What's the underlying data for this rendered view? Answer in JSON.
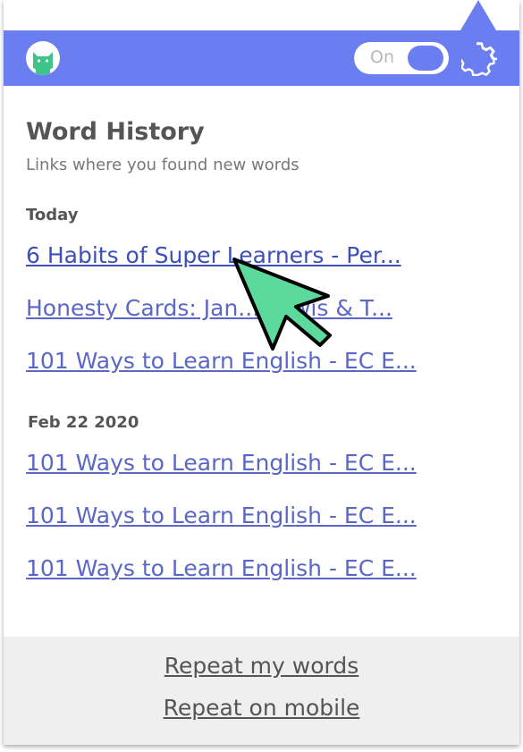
{
  "header": {
    "toggle_label": "On",
    "accent_color": "#6a7ef2",
    "logo_icon": "cat-mascot-icon",
    "settings_icon": "gear-icon"
  },
  "history": {
    "title": "Word History",
    "subtitle": "Links where you found new words",
    "groups": [
      {
        "date": "Today",
        "links": [
          "6 Habits of Super Learners - Per...",
          "Honesty Cards: Jan... Lewis & T...",
          "101 Ways to Learn English - EC E..."
        ]
      },
      {
        "date": "Feb 22 2020",
        "links": [
          "101 Ways to Learn English - EC E...",
          "101 Ways to Learn English - EC E...",
          "101 Ways to Learn English - EC E..."
        ]
      }
    ]
  },
  "footer": {
    "repeat_words": "Repeat my words",
    "repeat_mobile": "Repeat on mobile"
  },
  "cursor": {
    "color": "#5cd99c",
    "icon": "arrow-cursor-icon"
  }
}
